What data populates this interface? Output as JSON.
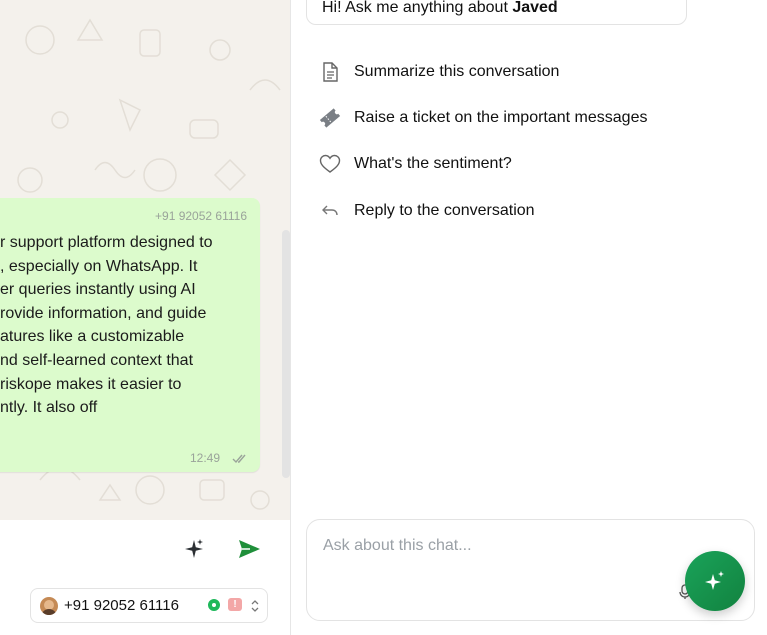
{
  "chat": {
    "message": {
      "sender": "+91 92052 61116",
      "lines": [
        "r support platform designed to",
        ", especially on WhatsApp. It",
        "er queries instantly using AI",
        "rovide information, and guide",
        "atures like a customizable",
        "nd self-learned context that",
        "riskope makes it easier to",
        "ntly. It also off"
      ],
      "time": "12:49"
    },
    "composer": {
      "number": "+91 92052 61116",
      "alert_badge": "!"
    }
  },
  "assistant": {
    "greeting_prefix": "Hi! Ask me anything about ",
    "greeting_name": "Javed",
    "suggestions": [
      {
        "label": "Summarize this conversation",
        "icon": "document-icon"
      },
      {
        "label": "Raise a ticket on the important messages",
        "icon": "ticket-icon"
      },
      {
        "label": "What's the sentiment?",
        "icon": "heart-icon"
      },
      {
        "label": "Reply to the conversation",
        "icon": "reply-icon"
      }
    ],
    "ask_placeholder": "Ask about this chat..."
  },
  "colors": {
    "accent_green": "#1aa35a",
    "bubble": "#dcfbcc",
    "send_green": "#1f8f3a"
  }
}
